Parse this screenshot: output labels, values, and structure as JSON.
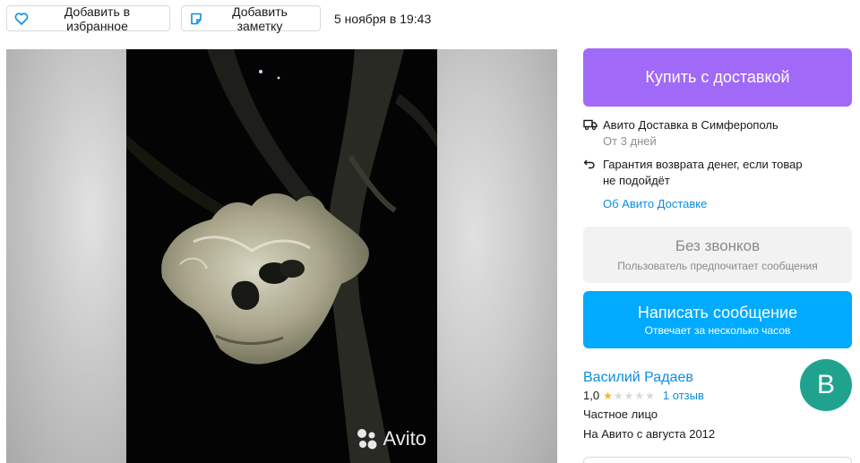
{
  "toolbar": {
    "favorite_label": "Добавить в избранное",
    "note_label": "Добавить заметку",
    "date": "5 ноября в 19:43"
  },
  "gallery": {
    "watermark": "Avito",
    "icon": "avito-logo-icon"
  },
  "purchase": {
    "buy_label": "Купить с доставкой",
    "delivery_title": "Авито Доставка в Симферополь",
    "delivery_time": "От 3 дней",
    "guarantee_line1": "Гарантия возврата денег, если товар",
    "guarantee_line2": "не подойдёт",
    "about_link": "Об Авито Доставке"
  },
  "contact": {
    "nocalls_title": "Без звонков",
    "nocalls_sub": "Пользователь предпочитает сообщения",
    "message_title": "Написать сообщение",
    "message_sub": "Отвечает за несколько часов"
  },
  "seller": {
    "name": "Василий Радаев",
    "rating": "1,0",
    "rating_value": 1,
    "rating_max": 5,
    "reviews": "1 отзыв",
    "type": "Частное лицо",
    "since": "На Авито с августа 2012",
    "avatar_letter": "В",
    "avatar_color": "#1fa38e"
  },
  "colors": {
    "buy_button": "#a169f7",
    "message_button": "#00aaff",
    "link": "#0a8ee0",
    "star": "#ffb021"
  }
}
